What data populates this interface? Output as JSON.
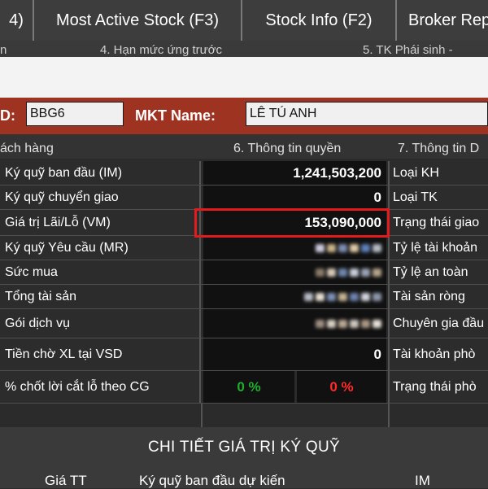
{
  "top_tabs": [
    {
      "label": "4)"
    },
    {
      "label": "Most Active Stock (F3)"
    },
    {
      "label": "Stock Info (F2)"
    },
    {
      "label": "Broker Rep"
    }
  ],
  "sub_nav": [
    "n",
    "4. Hạn mức ứng trước",
    "5. TK Phái sinh -"
  ],
  "account_bar": {
    "id_label": "D:",
    "id_value": "BBG6",
    "mkt_name_label": "MKT Name:",
    "mkt_name_value": "LÊ TÚ ANH"
  },
  "section_tabs": [
    "ách hàng",
    "6. Thông tin quyền",
    "7. Thông tin D"
  ],
  "rows": [
    {
      "label": "Ký quỹ ban đầu (IM)",
      "value": "1,241,503,200",
      "right_label": "Loại KH"
    },
    {
      "label": "Ký quỹ chuyển giao",
      "value": "0",
      "right_label": "Loại TK"
    },
    {
      "label": "Giá trị Lãi/Lỗ (VM)",
      "value": "153,090,000",
      "right_label": "Trạng thái giao"
    },
    {
      "label": "Ký quỹ Yêu cầu (MR)",
      "value": "",
      "right_label": "Tỷ lệ tài khoản"
    },
    {
      "label": "Sức mua",
      "value": "",
      "right_label": "Tỷ lệ an toàn"
    },
    {
      "label": "Tổng tài sản",
      "value": "",
      "right_label": "Tài sản ròng"
    },
    {
      "label": "Gói dịch vụ",
      "value": "",
      "right_label": "Chuyên gia đầu"
    },
    {
      "label": "Tiền chờ XL tại VSD",
      "value": "0",
      "right_label": "Tài khoản phò"
    }
  ],
  "take_profit_row": {
    "label": "% chốt lời cắt lỗ theo CG",
    "profit_pct": "0 %",
    "loss_pct": "0 %",
    "right_label": "Trạng thái phò"
  },
  "footer": {
    "title": "CHI TIẾT GIÁ TRỊ KÝ QUỸ",
    "columns": [
      "Giá TT",
      "Ký quỹ ban đầu dự kiến",
      "IM"
    ]
  },
  "colors": {
    "account_bar": "#9e3322",
    "highlight_box": "#e21c1c",
    "profit_text": "#1fae2e",
    "loss_text": "#ff2a2a"
  },
  "icons": []
}
